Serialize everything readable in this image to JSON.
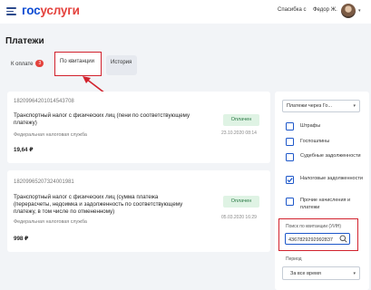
{
  "header": {
    "logo_part1": "гос",
    "logo_part2": "услуги",
    "link_help": "Спасибка с",
    "user_name": "Федор Ж.",
    "avatar_caret": "▾"
  },
  "page_title": "Платежи",
  "tabs": [
    {
      "label": "К оплате",
      "badge": "3"
    },
    {
      "label": "По квитанции"
    },
    {
      "label": "История"
    }
  ],
  "payments": [
    {
      "uin": "18209964201014543708",
      "title": "Транспортный налог с физических лиц (пени по соответствующему платежу)",
      "org": "Федеральная налоговая служба",
      "amount": "19,64 ₽",
      "status": "Оплачен",
      "date": "23.10.2020 08:14"
    },
    {
      "uin": "18209965207324001981",
      "title": "Транспортный налог с физических лиц (сумма платежа (перерасчеты, недоимка и задолженность по соответствующему платежу, в том числе по отмененному)",
      "org": "Федеральная налоговая служба",
      "amount": "998 ₽",
      "status": "Оплачен",
      "date": "05.03.2020 16:29"
    }
  ],
  "filters": {
    "type_select": "Платежи через Го...",
    "checkboxes": [
      {
        "label": "Штрафы",
        "checked": false
      },
      {
        "label": "Госпошлины",
        "checked": false
      },
      {
        "label": "Судебные задолженности",
        "checked": false
      },
      {
        "label": "Налоговые задолженности",
        "checked": true
      },
      {
        "label": "Прочие начисления и платежи",
        "checked": false
      }
    ],
    "search_label": "Поиск по квитанции (УИН)",
    "search_value": "4367829292992837",
    "period_label": "Период",
    "period_value": "За все время"
  },
  "colors": {
    "brand_blue": "#0d4cd3",
    "brand_red": "#e4423d",
    "highlight_red": "#d2222d",
    "status_green_bg": "#dff3e4",
    "status_green_text": "#2a7a45"
  }
}
